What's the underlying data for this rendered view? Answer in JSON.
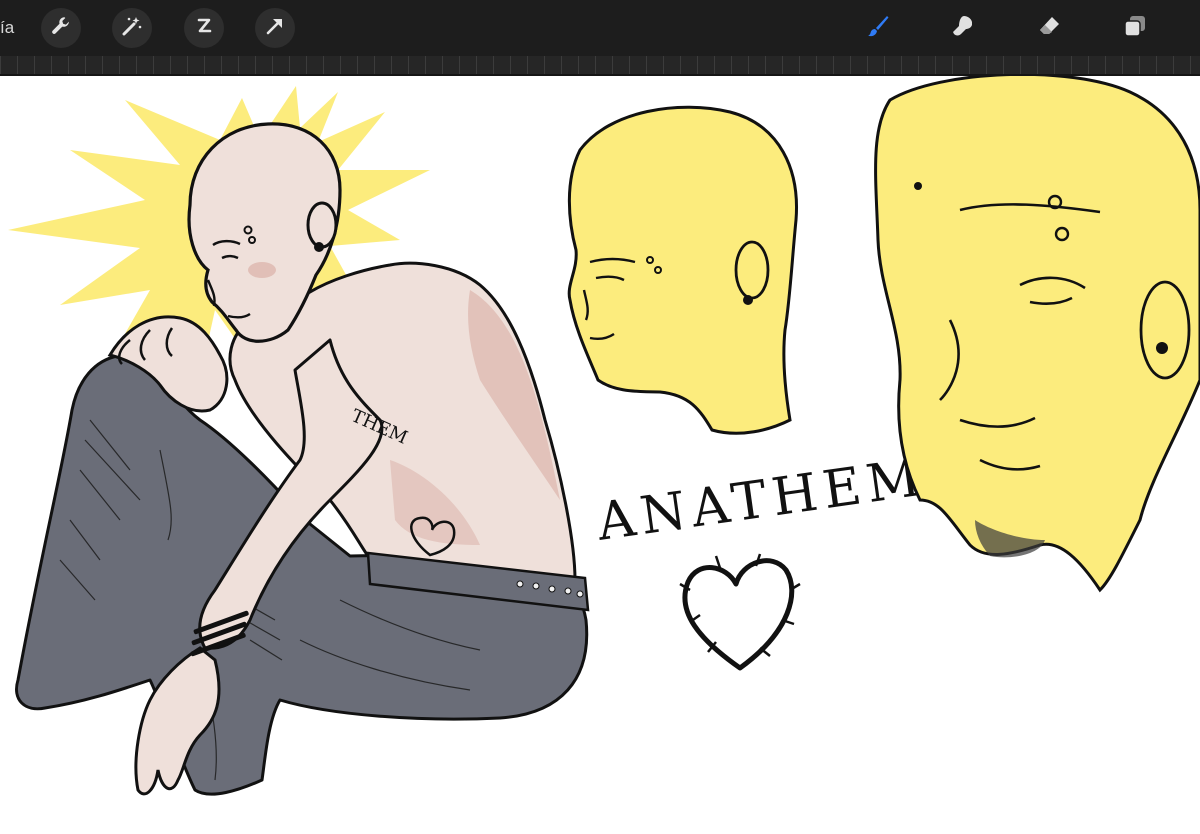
{
  "toolbar": {
    "gallery_label_partial": "ía",
    "left_tools": [
      "actions",
      "adjustments",
      "selection",
      "transform"
    ],
    "right_tools": [
      "brush",
      "smudge",
      "eraser",
      "layers"
    ],
    "active_tool": "brush",
    "active_color": "#2f7bf5",
    "background": "#1d1d1d"
  },
  "artwork": {
    "lettering": "ANATHEMA",
    "arm_tattoo": "THEM",
    "palette": {
      "highlight": "#fcec7d",
      "skin": "#efe0da",
      "skin_shadow": "#d7a9a0",
      "jeans": "#6a6d78",
      "ink": "#111111"
    }
  }
}
